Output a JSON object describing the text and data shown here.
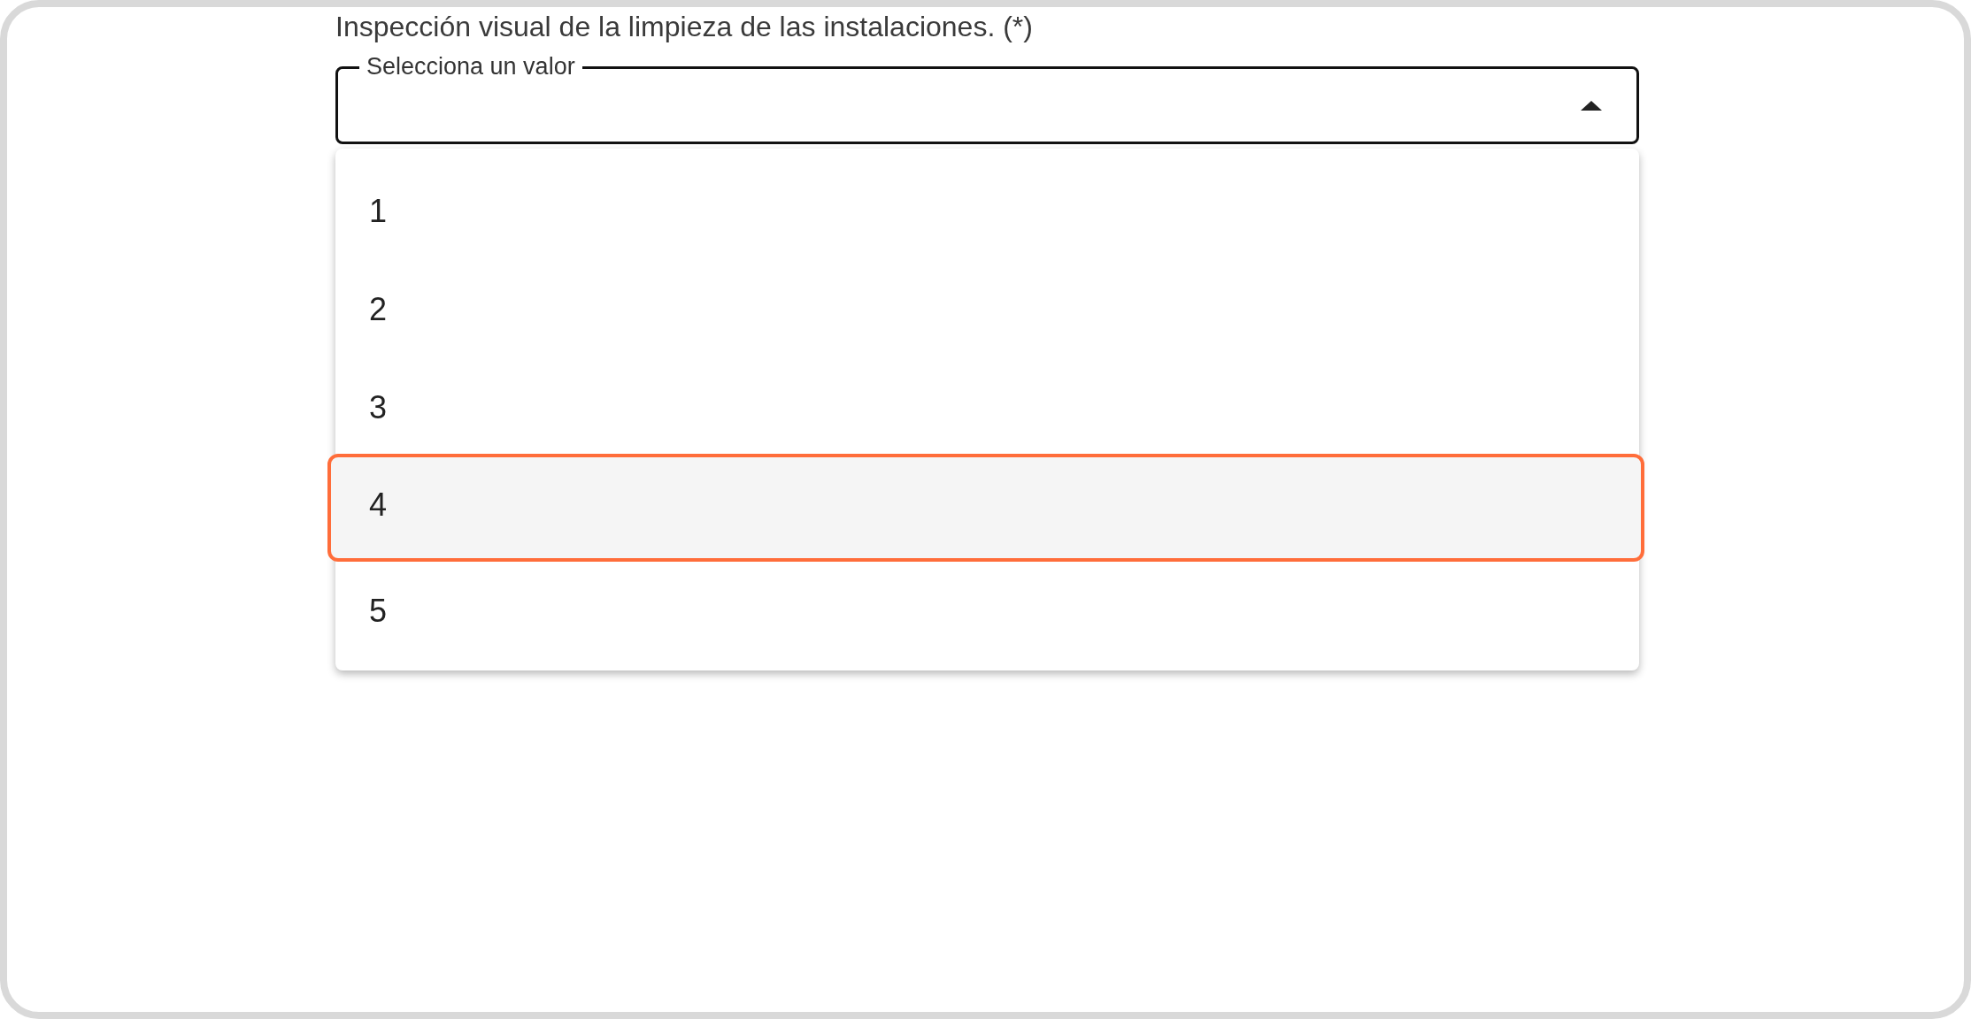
{
  "question": {
    "text": "Inspección visual de la limpieza de las instalaciones. (*)"
  },
  "select": {
    "label": "Selecciona un valor",
    "expanded": true
  },
  "options": [
    {
      "label": "1",
      "selected": false
    },
    {
      "label": "2",
      "selected": false
    },
    {
      "label": "3",
      "selected": false
    },
    {
      "label": "4",
      "selected": true
    },
    {
      "label": "5",
      "selected": false
    }
  ]
}
